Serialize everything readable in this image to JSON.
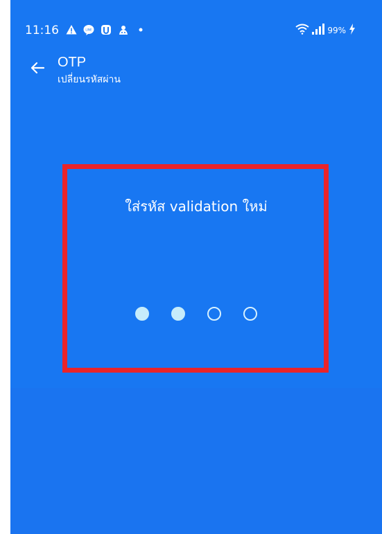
{
  "status_bar": {
    "time": "11:16",
    "battery": "99%",
    "notification_icons": [
      "warning-icon",
      "line-app-icon",
      "shield-app-icon",
      "app-badge-icon",
      "dot-icon"
    ],
    "right_icons": [
      "wifi-icon",
      "signal-icon",
      "charging-icon"
    ]
  },
  "app_bar": {
    "back_icon": "arrow-left-icon",
    "title": "OTP",
    "subtitle": "เปลี่ยนรหัสผ่าน"
  },
  "pin_entry": {
    "prompt": "ใส่รหัส validation ใหม่",
    "length": 4,
    "filled": 2
  },
  "annotation": {
    "color": "#e9242a"
  },
  "colors": {
    "background": "#1877f2",
    "text": "#ffffff",
    "dot": "#c6ecfb"
  }
}
